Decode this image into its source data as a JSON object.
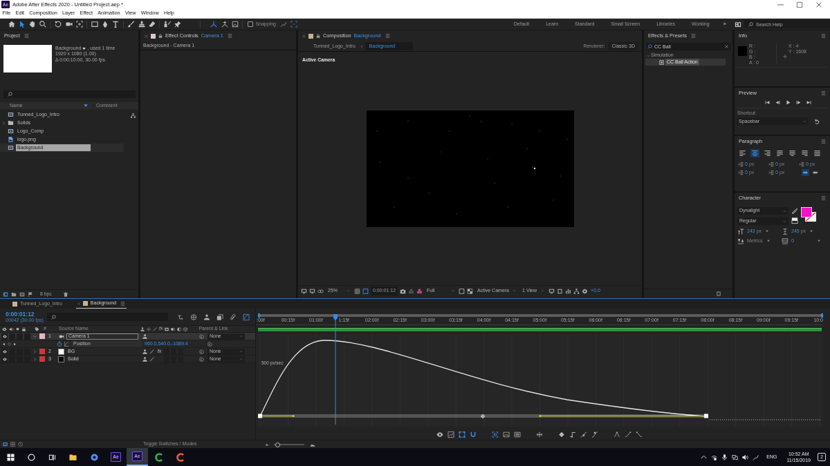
{
  "title_bar": {
    "app_badge": "Ae",
    "title": "Adobe After Effects 2020 - Untitled Project.aep *"
  },
  "menu": [
    "File",
    "Edit",
    "Composition",
    "Layer",
    "Effect",
    "Animation",
    "View",
    "Window",
    "Help"
  ],
  "toolbar": {
    "tools": [
      {
        "selected": false
      },
      {
        "selected": true
      },
      {
        "selected": false
      },
      {
        "selected": false
      },
      {
        "selected": false
      },
      {
        "selected": false
      },
      {
        "selected": false
      },
      {
        "selected": false
      },
      {
        "selected": false
      },
      {
        "selected": false
      },
      {
        "selected": false
      },
      {
        "selected": false
      },
      {
        "selected": false
      },
      {
        "selected": false
      },
      {
        "selected": false
      }
    ],
    "axis_modes": [
      {
        "selected": true
      },
      {
        "selected": false
      },
      {
        "selected": false
      }
    ],
    "snapping": {
      "label": "Snapping",
      "checked": false
    },
    "workspaces": [
      "Default",
      "Learn",
      "Standard",
      "Small Screen",
      "Libraries",
      "Working"
    ],
    "overflow": "»",
    "search": {
      "placeholder": "Search Help"
    }
  },
  "project": {
    "title": "Project",
    "thumbnail": {
      "name": "Background",
      "usage": ", used 1 time",
      "size": "1920 x 1080 (1.00)",
      "duration": "Δ 0:00:10:00, 30.00 fps"
    },
    "columns": [
      "Name",
      "Comment"
    ],
    "items": [
      {
        "name": "Tunned_Logo_Intro",
        "kind": "comp",
        "selected": false
      },
      {
        "name": "Solids",
        "kind": "folder",
        "expanded": false,
        "selected": false
      },
      {
        "name": "Logo_Comp",
        "kind": "comp",
        "selected": false
      },
      {
        "name": "logo.png",
        "kind": "image",
        "selected": false
      },
      {
        "name": "Background",
        "kind": "comp",
        "selected": true
      }
    ],
    "bit_depth": "8 bpc"
  },
  "effect_controls": {
    "title": "Effect Controls",
    "layer": "Camera 1",
    "breadcrumb": "Background - Camera 1"
  },
  "composition": {
    "title": "Composition",
    "name": "Background",
    "breadcrumbs": [
      {
        "label": "Tunned_Logo_Intro",
        "selected": false
      },
      {
        "label": "Background",
        "selected": true
      }
    ],
    "renderer_label": "Renderer:",
    "renderer": "Classic 3D",
    "view_label": "Active Camera",
    "footer": {
      "zoom": "25%",
      "timecode": "0:00:01:12",
      "resolution": "Full",
      "camera": "Active Camera",
      "views": "1 View",
      "exposure": "+0.0"
    }
  },
  "effects_presets": {
    "title": "Effects & Presets",
    "search": {
      "value": "CC Ball"
    },
    "tree": [
      {
        "label": "Simulation",
        "expanded": true,
        "children": [
          {
            "label": "CC Ball Action",
            "selected": true
          }
        ]
      }
    ]
  },
  "info": {
    "title": "Info",
    "channels": [
      "R :",
      "G :",
      "B :",
      "A : 0"
    ],
    "x": "X : 4",
    "y": "Y : 1608"
  },
  "preview": {
    "title": "Preview",
    "shortcut_label": "Shortcut",
    "shortcut": "Spacebar"
  },
  "paragraph": {
    "title": "Paragraph",
    "alignments": [
      {
        "selected": false
      },
      {
        "selected": true
      },
      {
        "selected": false
      },
      {
        "selected": false
      },
      {
        "selected": false
      },
      {
        "selected": false
      },
      {
        "selected": false
      }
    ],
    "indents": [
      {
        "value": "0",
        "unit": "px"
      },
      {
        "value": "0",
        "unit": "px"
      },
      {
        "value": "0",
        "unit": "px"
      },
      {
        "value": "0",
        "unit": "px"
      },
      {
        "value": "0",
        "unit": "px"
      }
    ],
    "directions": [
      {
        "selected": true
      },
      {
        "selected": false
      }
    ]
  },
  "character": {
    "title": "Character",
    "font": "Dynalight",
    "style": "Regular",
    "size": {
      "value": "243",
      "unit": "px"
    },
    "leading": {
      "value": "245",
      "unit": "px"
    },
    "kerning": "Metrics",
    "tracking": "0"
  },
  "timeline": {
    "tabs": [
      {
        "label": "Tunned_Logo_Intro",
        "selected": false
      },
      {
        "label": "Background",
        "selected": true
      }
    ],
    "timecode": "0:00:01:12",
    "frame_info": "00042 (30.00 fps)",
    "header_buttons": [
      {
        "on": false
      },
      {
        "on": false
      },
      {
        "on": false
      },
      {
        "on": false
      },
      {
        "on": false
      },
      {
        "on": true
      }
    ],
    "columns": {
      "number": "#",
      "source": "Source Name",
      "effects": "fx",
      "parent": "Parent & Link"
    },
    "layers": [
      {
        "number": "1",
        "name": "Camera 1",
        "kind": "camera",
        "color": "#e8b6c8",
        "selected": true,
        "expanded": true,
        "parent": "None",
        "property": {
          "name": "Position",
          "value": "960.0,540.0,-1089.4"
        }
      },
      {
        "number": "2",
        "name": "BG",
        "kind": "solid",
        "color": "#c83a3a",
        "solid": {
          "color": "#ffffff"
        },
        "effects": "fx",
        "selected": false,
        "expanded": false,
        "parent": "None"
      },
      {
        "number": "3",
        "name": "Solid",
        "kind": "solid",
        "color": "#c83a3a",
        "solid": {
          "color": "#000000"
        },
        "selected": false,
        "expanded": false,
        "parent": "None"
      }
    ],
    "ruler": [
      ":00f",
      "00:15f",
      "01:00f",
      "1:15f",
      "02:00f",
      "02:15f",
      "03:00f",
      "03:15f",
      "04:00f",
      "04:15f",
      "05:00f",
      "05:15f",
      "06:00f",
      "06:15f",
      "07:00f",
      "07:15f",
      "08:00f",
      "08:15f",
      "09:00f",
      "09:15f",
      "10:0"
    ],
    "graph_label": "500 px/sec",
    "graph_buttons": [
      {
        "on": false
      },
      {
        "on": false
      },
      {
        "on": true
      },
      {
        "on": true
      },
      {
        "on": true
      },
      {
        "on": false
      },
      {
        "on": false
      },
      {
        "on": false
      },
      {
        "on": false
      },
      {
        "on": false
      },
      {
        "on": false
      },
      {
        "on": false
      },
      {
        "on": false
      },
      {
        "on": false
      },
      {
        "on": false
      }
    ],
    "toggle_label": "Toggle Switches / Modes",
    "zoom_slider": {
      "level": 0.12
    }
  },
  "taskbar": {
    "apps": [
      {
        "kind": "folder",
        "active": false
      },
      {
        "kind": "browser",
        "active": false
      },
      {
        "kind": "badge",
        "badge": "Ae",
        "active": false
      },
      {
        "kind": "badge",
        "badge": "Ae",
        "active": true
      },
      {
        "kind": "ring",
        "color": "#34b24a",
        "active": false
      },
      {
        "kind": "ring",
        "color": "#f05a3a",
        "active": false
      }
    ],
    "language": "ENG",
    "time": "10:52 AM",
    "date": "11/15/2019",
    "notifications": "2"
  }
}
